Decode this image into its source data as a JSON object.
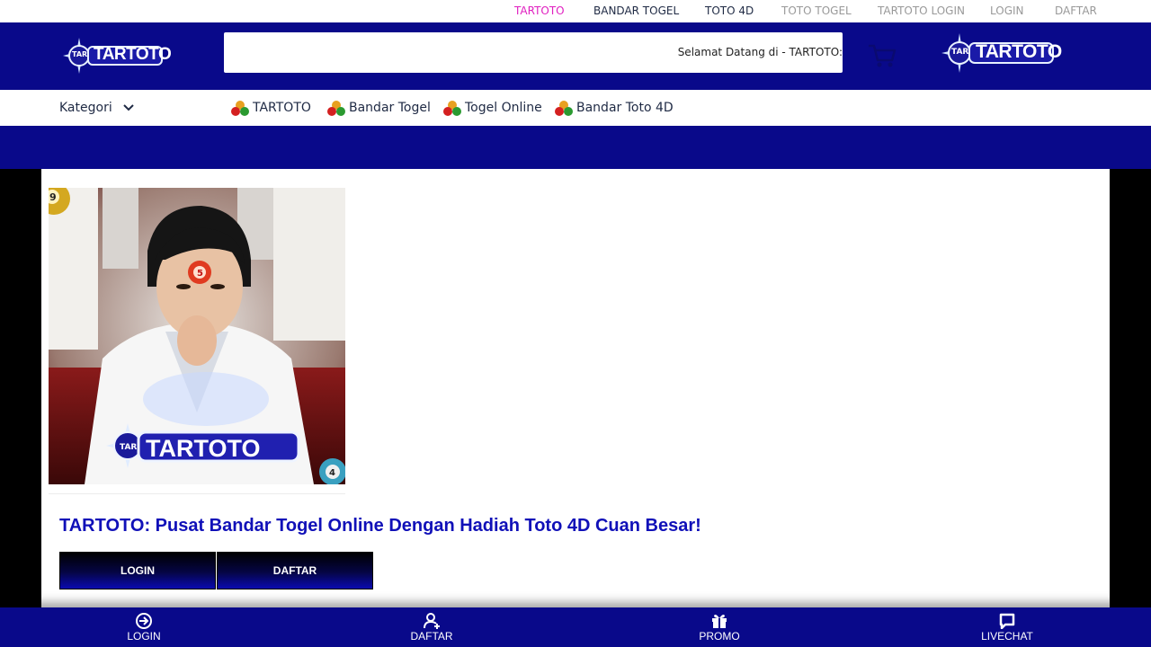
{
  "topnav": {
    "links": [
      "TARTOTO",
      "BANDAR TOGEL",
      "TOTO 4D",
      "TOTO TOGEL",
      "TARTOTO LOGIN",
      "LOGIN",
      "DAFTAR"
    ],
    "colors": [
      "#e020c0",
      "#1f2a44",
      "#1f2a44",
      "#999999",
      "#999999",
      "#999999",
      "#999999"
    ]
  },
  "header": {
    "logo_text": "TARTOTO",
    "logo_badge": "TAR",
    "welcome": "Selamat Datang di - TARTOTO:",
    "cart_icon": "shopping-cart-icon"
  },
  "categories": {
    "label": "Kategori",
    "items": [
      "TARTOTO",
      "Bandar Togel",
      "Togel Online",
      "Bandar Toto 4D"
    ]
  },
  "hero": {
    "logo_text": "TARTOTO",
    "logo_badge": "TAR",
    "ball_top": "9",
    "ball_mid": "5",
    "ball_bottom": "4"
  },
  "content": {
    "title": "TARTOTO: Pusat Bandar Togel Online Dengan Hadiah Toto 4D Cuan Besar!",
    "login_label": "LOGIN",
    "daftar_label": "DAFTAR"
  },
  "bottomnav": {
    "items": [
      "LOGIN",
      "DAFTAR",
      "PROMO",
      "LIVECHAT"
    ]
  },
  "colors": {
    "brand_blue": "#09098a",
    "title_blue": "#1010b8",
    "accent_pink": "#e020c0"
  }
}
